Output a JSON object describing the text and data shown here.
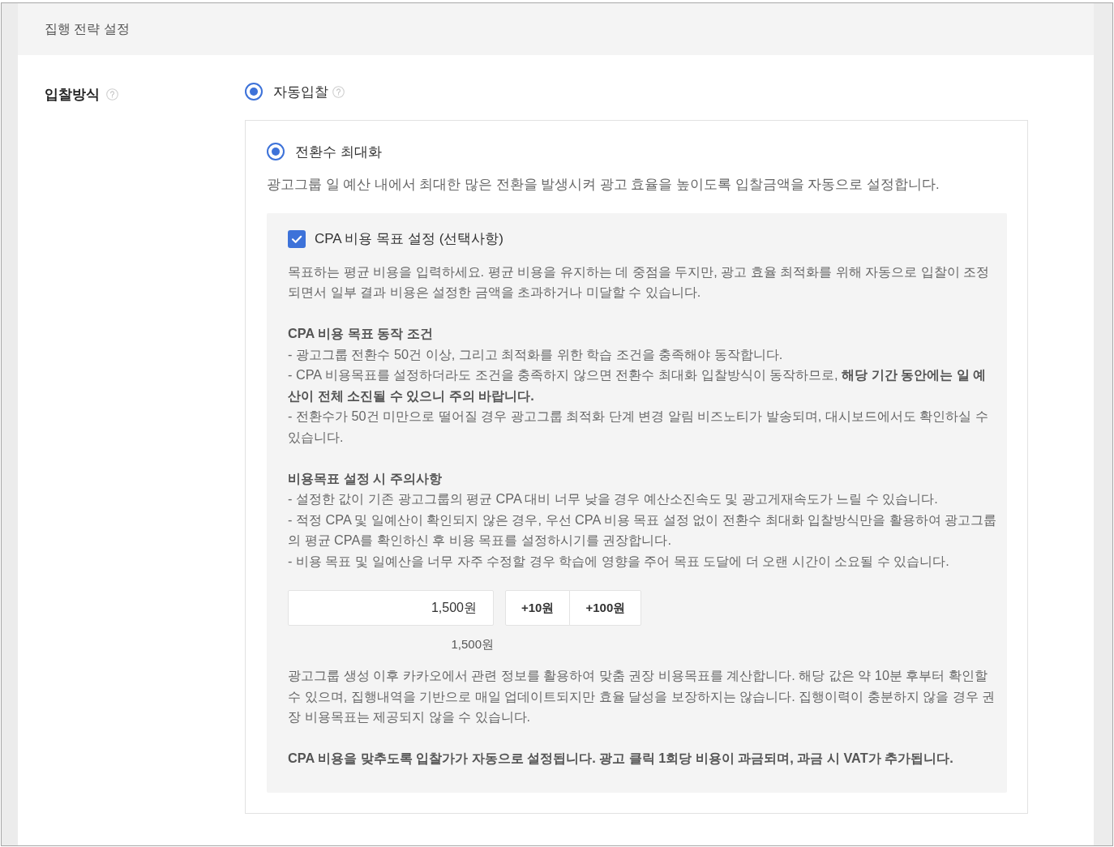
{
  "section": {
    "title": "집행 전략 설정"
  },
  "bid_field": {
    "label": "입찰방식",
    "bidding_methods": [
      {
        "label": "자동입찰",
        "selected": true
      }
    ],
    "strategies": [
      {
        "label": "전환수 최대화",
        "selected": true,
        "description": "광고그룹 일 예산 내에서 최대한 많은 전환을 발생시켜 광고 효율을 높이도록 입찰금액을 자동으로 설정합니다."
      }
    ],
    "cpa_goal": {
      "label": "CPA 비용 목표 설정 (선택사항)",
      "checked": true,
      "intro": "목표하는 평균 비용을 입력하세요. 평균 비용을 유지하는 데 중점을 두지만, 광고 효율 최적화를 위해 자동으로 입찰이 조정되면서 일부 결과 비용은 설정한 금액을 초과하거나 미달할 수 있습니다.",
      "sections": [
        {
          "heading": "CPA 비용 목표 동작 조건",
          "items": [
            "- 광고그룹 전환수 50건 이상, 그리고 최적화를 위한 학습 조건을 충족해야 동작합니다.",
            "- CPA 비용목표를 설정하더라도 조건을 충족하지 않으면 전환수 최대화 입찰방식이 동작하므로, **해당 기간 동안에는 일 예산이 전체 소진될 수 있으니 주의 바랍니다.**",
            "- 전환수가 50건 미만으로 떨어질 경우 광고그룹 최적화 단계 변경 알림 비즈노티가 발송되며, 대시보드에서도 확인하실 수 있습니다."
          ]
        },
        {
          "heading": "비용목표 설정 시 주의사항",
          "items": [
            "- 설정한 값이 기존 광고그룹의 평균 CPA 대비 너무 낮을 경우 예산소진속도 및 광고게재속도가 느릴 수 있습니다.",
            "- 적정 CPA 및 일예산이 확인되지 않은 경우, 우선 CPA 비용 목표 설정 없이 전환수 최대화 입찰방식만을 활용하여 광고그룹의 평균 CPA를 확인하신 후 비용 목표를 설정하시기를 권장합니다.",
            "- 비용 목표 및 일예산을 너무 자주 수정할 경우 학습에 영향을 주어 목표 도달에 더 오랜 시간이 소요될 수 있습니다."
          ]
        }
      ],
      "amount_input": {
        "value": "1,500원"
      },
      "buttons": [
        "+10원",
        "+100원"
      ],
      "amount_caption": "1,500원",
      "note": "광고그룹 생성 이후 카카오에서 관련 정보를 활용하여 맞춤 권장 비용목표를 계산합니다. 해당 값은 약 10분 후부터 확인할 수 있으며, 집행내역을 기반으로 매일 업데이트되지만 효율 달성을 보장하지는 않습니다. 집행이력이 충분하지 않을 경우 권장 비용목표는 제공되지 않을 수 있습니다.",
      "footer": "CPA 비용을 맞추도록 입찰가가 자동으로 설정됩니다. 광고 클릭 1회당 비용이 과금되며, 과금 시 VAT가 추가됩니다."
    }
  }
}
